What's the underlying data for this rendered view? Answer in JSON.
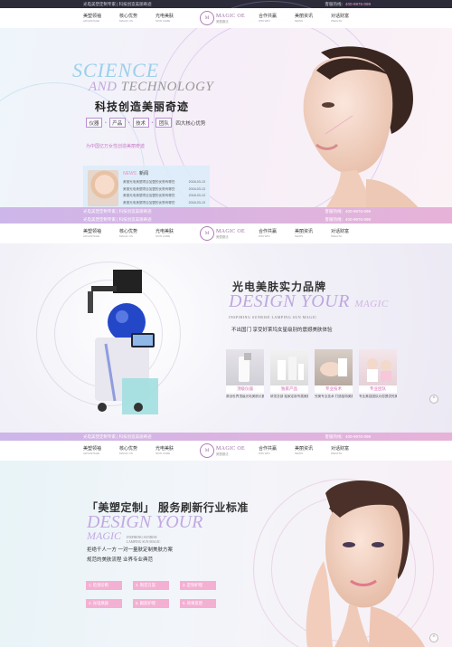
{
  "topbar": {
    "left": "光电美塑定制专家 | 科技创造美丽奇迹",
    "hotline_label": "客服热线：",
    "hotline": "400-9976-099"
  },
  "nav": {
    "left": [
      {
        "zh": "美塑领袖",
        "en": "ADVANTAGE"
      },
      {
        "zh": "核心优势",
        "en": "MAGIC US"
      },
      {
        "zh": "光电美肤",
        "en": "SKIN CARE"
      }
    ],
    "logo": {
      "mark": "M",
      "en": "MAGIC OE",
      "zh": "美塑魔法"
    },
    "right": [
      {
        "zh": "合作共赢",
        "en": "WIN WIN"
      },
      {
        "zh": "美丽资讯",
        "en": "NEWS"
      },
      {
        "zh": "对话财富",
        "en": "WEALTH"
      }
    ]
  },
  "hero1": {
    "science": "SCIENCE",
    "and": "AND",
    "tech": "TECHNOLOGY",
    "headline": "科技创造美丽奇迹",
    "tags": [
      "仪器",
      "产品",
      "技术",
      "团队"
    ],
    "tags_suffix": "四大核心优势",
    "tagline": "为中国亿万女性创造美丽奇迹",
    "news": {
      "en": "NEWS",
      "zh": "新闻",
      "rows": [
        {
          "title": "美丽光电美塑项目加盟的优势有哪些",
          "date": "2018-03-13"
        },
        {
          "title": "美丽光电美塑项目加盟的优势有哪些",
          "date": "2018-03-13"
        },
        {
          "title": "美丽光电美塑项目加盟的优势有哪些",
          "date": "2018-03-13"
        },
        {
          "title": "美丽光电美塑项目加盟的优势有哪些",
          "date": "2018-03-13"
        }
      ]
    }
  },
  "hero2": {
    "title": "光电美肤实力品牌",
    "design": "DESIGN YOUR",
    "magic": "MAGIC",
    "sub": "INSPIRING SUNRISE LAMPING SUN MAGIC",
    "desc": "不出国门 享受好莱坞女星级别的震撼美肤体验",
    "cards": [
      {
        "cap": "顶级仪器",
        "desc": "原创世界顶级光电美肤仪器"
      },
      {
        "cap": "独家产品",
        "desc": "研发总部 独家定制专属美肤产品"
      },
      {
        "cap": "专业技术",
        "desc": "完美专业技术 打造独特美肤"
      },
      {
        "cap": "专业团队",
        "desc": "专业美容团队为您提供完美服务"
      }
    ]
  },
  "hero3": {
    "title_quote_open": "「",
    "title_word": "美塑定制",
    "title_quote_close": "」",
    "title_rest": "服务刷新行业标准",
    "design": "DESIGN YOUR",
    "sub1": "INSPIRING SUNRISE",
    "sub2": "LAMPING SUN MAGIC",
    "magic": "MAGIC",
    "line1": "拒绝千人一方   一对一量肤定制美肤方案",
    "line2": "规范的美肤流程   业界专业典范",
    "buttons": [
      "1. 检测诊断",
      "2. 制定方案",
      "3. 定制护理",
      "4. 光电焕颜",
      "5. 跟踪护理",
      "6. 效果反馈"
    ]
  },
  "colors": {
    "accent": "#c77ac9",
    "button": "#f4b0d3",
    "topbar": "#2b2b3a"
  },
  "icons": {
    "back_to_top": "^"
  }
}
